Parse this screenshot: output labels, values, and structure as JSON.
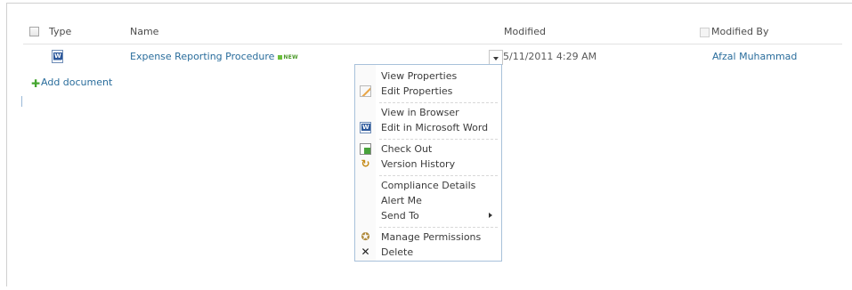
{
  "columns": {
    "type": "Type",
    "name": "Name",
    "modified": "Modified",
    "modified_by": "Modified By"
  },
  "row": {
    "name": "Expense Reporting Procedure",
    "new_badge": "NEW",
    "modified": "5/11/2011 4:29 AM",
    "modified_by": "Afzal Muhammad",
    "icon": "word-document-icon"
  },
  "add_document": {
    "label": "Add document",
    "icon": "plus-icon"
  },
  "menu": {
    "items": [
      {
        "label": "View Properties",
        "icon": ""
      },
      {
        "label": "Edit Properties",
        "icon": "edit-properties-icon"
      },
      {
        "label": "View in Browser",
        "icon": ""
      },
      {
        "label": "Edit in Microsoft Word",
        "icon": "word-icon"
      },
      {
        "label": "Check Out",
        "icon": "check-out-icon"
      },
      {
        "label": "Version History",
        "icon": "version-history-icon"
      },
      {
        "label": "Compliance Details",
        "icon": ""
      },
      {
        "label": "Alert Me",
        "icon": ""
      },
      {
        "label": "Send To",
        "icon": "",
        "submenu": true
      },
      {
        "label": "Manage Permissions",
        "icon": "manage-permissions-icon"
      },
      {
        "label": "Delete",
        "icon": "delete-icon"
      }
    ]
  },
  "colors": {
    "link": "#2a6d9c",
    "menu_border": "#a8c1da",
    "add_icon": "#45a630"
  }
}
